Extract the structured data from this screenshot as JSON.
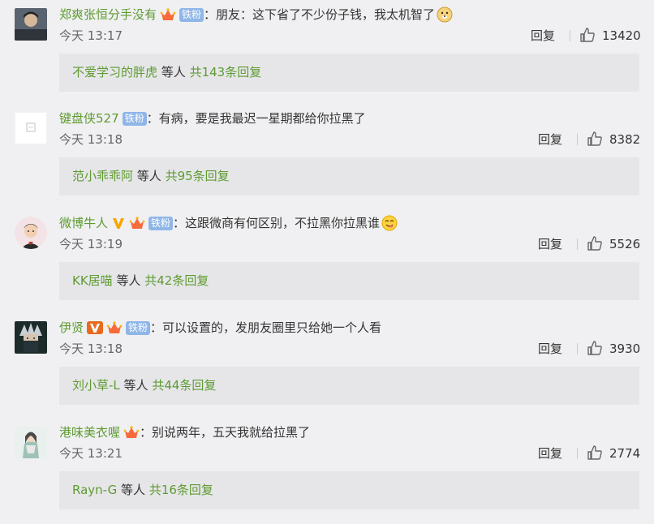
{
  "comments": [
    {
      "username": "郑爽张恒分手没有",
      "has_v": false,
      "has_crown": true,
      "fan_badge": "铁粉",
      "text": "：朋友：这下省了不少份子钱，我太机智了",
      "emoji": "doge-emoji",
      "time": "今天 13:17",
      "reply_label": "回复",
      "likes": "13420",
      "reply_user": "不爱学习的胖虎",
      "reply_mid": " 等人 ",
      "reply_count": "共143条回复"
    },
    {
      "username": "键盘侠527",
      "has_v": false,
      "has_crown": false,
      "fan_badge": "铁粉",
      "text": "：有病，要是我最迟一星期都给你拉黑了",
      "emoji": "",
      "time": "今天 13:18",
      "reply_label": "回复",
      "likes": "8382",
      "reply_user": "范小乖乖阿",
      "reply_mid": " 等人 ",
      "reply_count": "共95条回复"
    },
    {
      "username": "微博牛人",
      "has_v": true,
      "v_color": "#f7a600",
      "has_crown": true,
      "fan_badge": "铁粉",
      "text": "：这跟微商有何区别，不拉黑你拉黑谁",
      "emoji": "yummy-emoji",
      "time": "今天 13:19",
      "reply_label": "回复",
      "likes": "5526",
      "reply_user": "KK居喵",
      "reply_mid": " 等人 ",
      "reply_count": "共42条回复"
    },
    {
      "username": "伊贤",
      "has_v": true,
      "v_color": "#e86a1f",
      "has_crown": true,
      "fan_badge": "铁粉",
      "text": "：可以设置的，发朋友圈里只给她一个人看",
      "emoji": "",
      "time": "今天 13:18",
      "reply_label": "回复",
      "likes": "3930",
      "reply_user": "刘小草-L",
      "reply_mid": " 等人 ",
      "reply_count": "共44条回复"
    },
    {
      "username": "港味美衣喔",
      "has_v": false,
      "has_crown": true,
      "fan_badge": "",
      "text": "：别说两年，五天我就给拉黑了",
      "emoji": "",
      "time": "今天 13:21",
      "reply_label": "回复",
      "likes": "2774",
      "reply_user": "Rayn-G",
      "reply_mid": " 等人 ",
      "reply_count": "共16条回复"
    }
  ],
  "colors": {
    "username": "#5e9b31",
    "background": "#f0f0f2",
    "reply_box": "#e6e6e9",
    "fan_badge": "#8fb6e8"
  }
}
